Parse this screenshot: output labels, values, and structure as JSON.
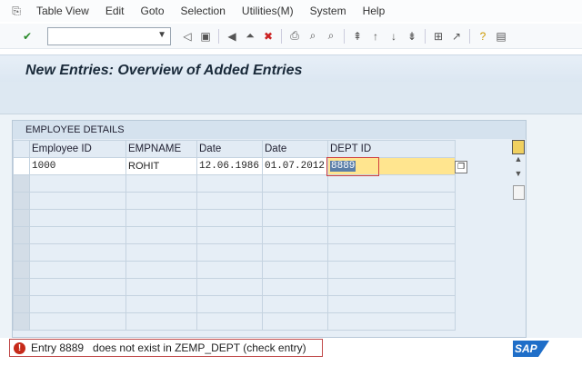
{
  "menu": [
    "Table View",
    "Edit",
    "Goto",
    "Selection",
    "Utilities(M)",
    "System",
    "Help"
  ],
  "command_field": {
    "value": ""
  },
  "title": "New Entries: Overview of Added Entries",
  "group": {
    "title": "EMPLOYEE DETAILS",
    "columns": [
      "Employee ID",
      "EMPNAME",
      "Date",
      "Date",
      "DEPT ID"
    ],
    "rows": [
      {
        "emp_id": "1000",
        "name": "ROHIT",
        "date1": "12.06.1986",
        "date2": "01.07.2012",
        "dept_id": "8889"
      }
    ]
  },
  "status": {
    "type": "error",
    "message": "Entry 8889   does not exist in ZEMP_DEPT (check entry)"
  },
  "logo": "SAP",
  "colors": {
    "title_bg": "#dce7f2",
    "error": "#c62a1a",
    "highlight": "#ffe58f"
  }
}
